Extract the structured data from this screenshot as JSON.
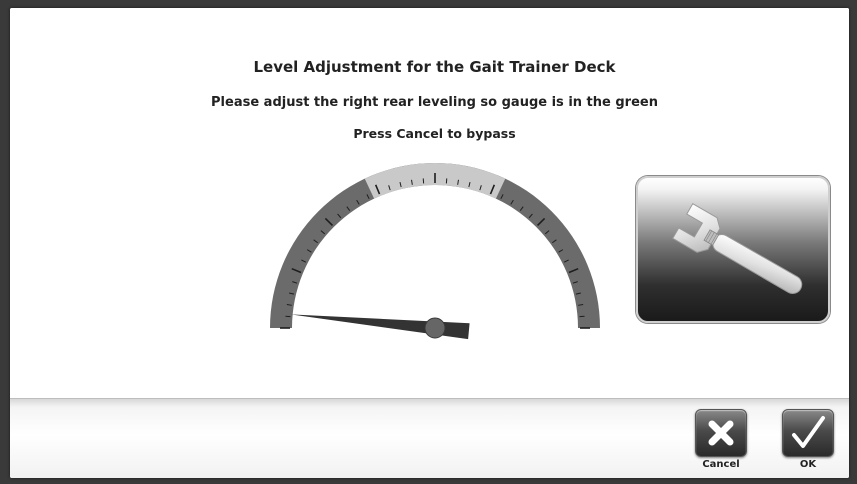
{
  "dialog": {
    "title": "Level Adjustment for the Gait Trainer Deck",
    "instruction": "Please adjust the right rear leveling so gauge is in the green",
    "bypass_hint": "Press Cancel to bypass"
  },
  "gauge": {
    "name": "level-gauge",
    "needle_fraction": 0.03,
    "green_zone_start_fraction": 0.36,
    "green_zone_end_fraction": 0.64,
    "tick_count": 40,
    "colors": {
      "outer_band": "#6b6b6b",
      "green_zone": "#c9c9c9",
      "needle": "#333333",
      "hub": "#666666"
    }
  },
  "tool_tile": {
    "icon": "wrench-icon"
  },
  "footer": {
    "cancel_label": "Cancel",
    "cancel_icon": "x-icon",
    "ok_label": "OK",
    "ok_icon": "checkmark-icon"
  }
}
